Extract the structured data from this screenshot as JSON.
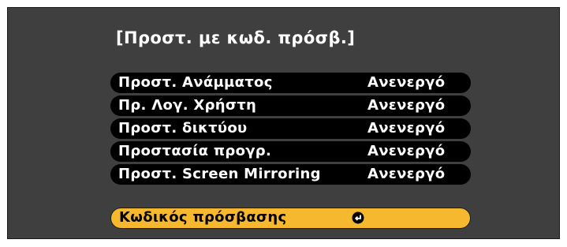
{
  "dialog": {
    "title": "[Προστ. με κωδ. πρόσβ.]"
  },
  "menu": {
    "items": [
      {
        "label": "Προστ. Ανάμματος",
        "value": "Ανενεργό"
      },
      {
        "label": "Πρ. Λογ. Χρήστη",
        "value": "Ανενεργό"
      },
      {
        "label": "Προστ. δικτύου",
        "value": "Ανενεργό"
      },
      {
        "label": "Προστασία προγρ.",
        "value": "Ανενεργό"
      },
      {
        "label": "Προστ. Screen Mirroring",
        "value": "Ανενεργό"
      }
    ],
    "password": {
      "label": "Κωδικός πρόσβασης",
      "icon": "enter-icon"
    }
  },
  "colors": {
    "background": "#3f3f3f",
    "item_background": "#000000",
    "selected_background": "#f5b82e",
    "text": "#ffffff"
  }
}
